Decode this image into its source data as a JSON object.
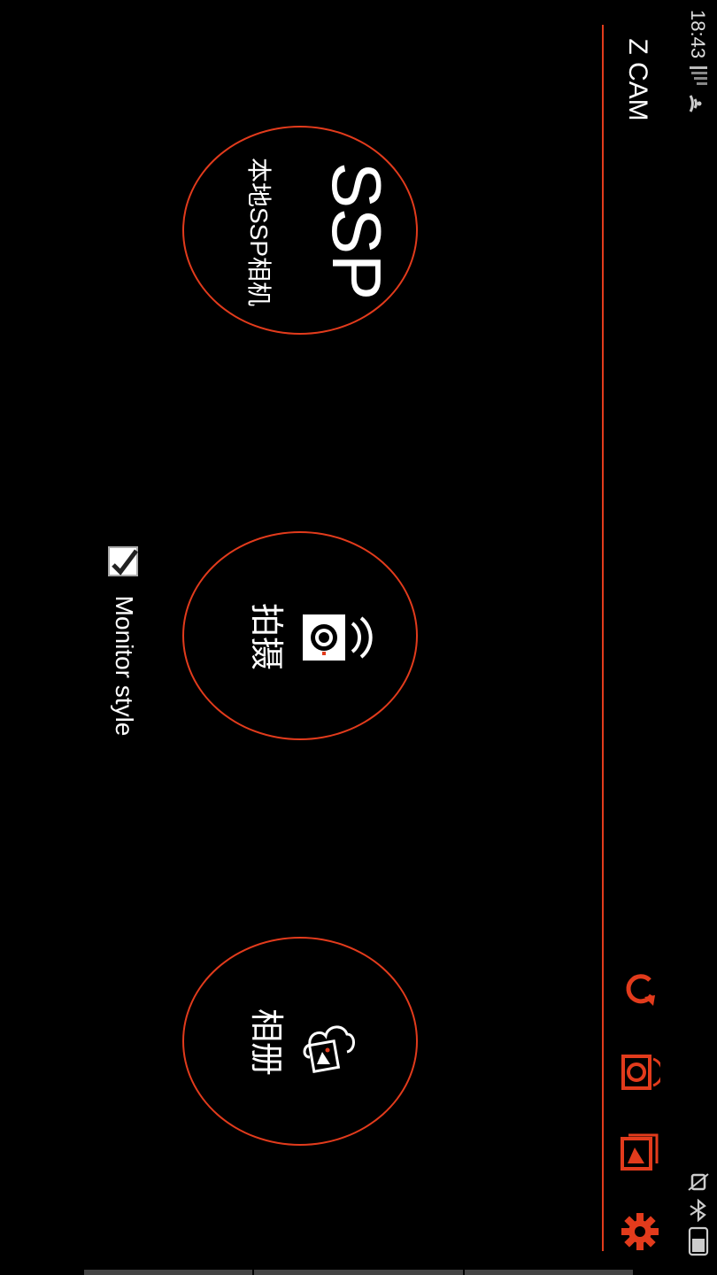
{
  "status_bar": {
    "time": "18:43",
    "icons": [
      "signal-icon",
      "wifi-icon",
      "vibrate-icon",
      "bluetooth-icon",
      "battery-icon"
    ]
  },
  "app_bar": {
    "title": "Z CAM",
    "actions": [
      {
        "name": "refresh-icon"
      },
      {
        "name": "camera-wifi-icon"
      },
      {
        "name": "gallery-icon"
      },
      {
        "name": "settings-icon"
      }
    ],
    "accent": "#e23b1c"
  },
  "main": {
    "ssp": {
      "title": "SSP",
      "subtitle": "本地SSP相机"
    },
    "shoot": {
      "label": "拍摄",
      "icon": "camera-wifi-icon"
    },
    "album": {
      "label": "相册",
      "icon": "cloud-photos-icon"
    }
  },
  "monitor_style": {
    "label": "Monitor style",
    "checked": true
  }
}
